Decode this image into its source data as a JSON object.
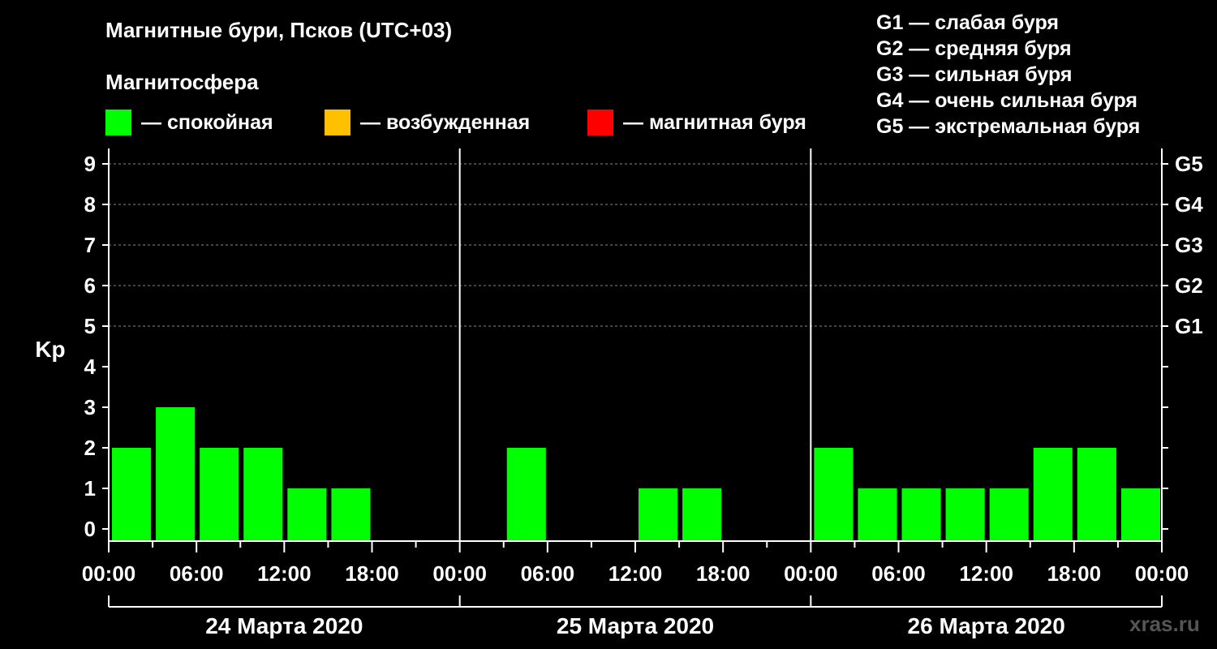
{
  "header": {
    "title": "Магнитные бури, Псков (UTC+03)",
    "subtitle": "Магнитосфера"
  },
  "legend": [
    {
      "label": "— спокойная",
      "color": "#00ff00"
    },
    {
      "label": "— возбужденная",
      "color": "#ffc000"
    },
    {
      "label": "— магнитная буря",
      "color": "#ff0000"
    }
  ],
  "storm_levels": [
    "G1 — слабая буря",
    "G2 — средняя буря",
    "G3 — сильная буря",
    "G4 — очень сильная буря",
    "G5 — экстремальная буря"
  ],
  "watermark": "xras.ru",
  "chart_data": {
    "type": "bar",
    "ylabel": "Kp",
    "ylim": [
      0,
      9
    ],
    "yticks": [
      0,
      1,
      2,
      3,
      4,
      5,
      6,
      7,
      8,
      9
    ],
    "right_tick_labels": [
      {
        "value": 5,
        "label": "G1"
      },
      {
        "value": 6,
        "label": "G2"
      },
      {
        "value": 7,
        "label": "G3"
      },
      {
        "value": 8,
        "label": "G4"
      },
      {
        "value": 9,
        "label": "G5"
      }
    ],
    "grid": "dashed horizontal at 5–9",
    "days": [
      {
        "label": "24 Марта 2020",
        "values": [
          2,
          3,
          2,
          2,
          1,
          1,
          0,
          0
        ]
      },
      {
        "label": "25 Марта 2020",
        "values": [
          0,
          2,
          0,
          0,
          1,
          1,
          0,
          0
        ]
      },
      {
        "label": "26 Марта 2020",
        "values": [
          2,
          1,
          1,
          1,
          1,
          2,
          2,
          1
        ]
      }
    ],
    "xtick_labels": [
      "00:00",
      "06:00",
      "12:00",
      "18:00",
      "00:00",
      "06:00",
      "12:00",
      "18:00",
      "00:00",
      "06:00",
      "12:00",
      "18:00",
      "00:00"
    ],
    "bar_color": "#00ff00"
  }
}
